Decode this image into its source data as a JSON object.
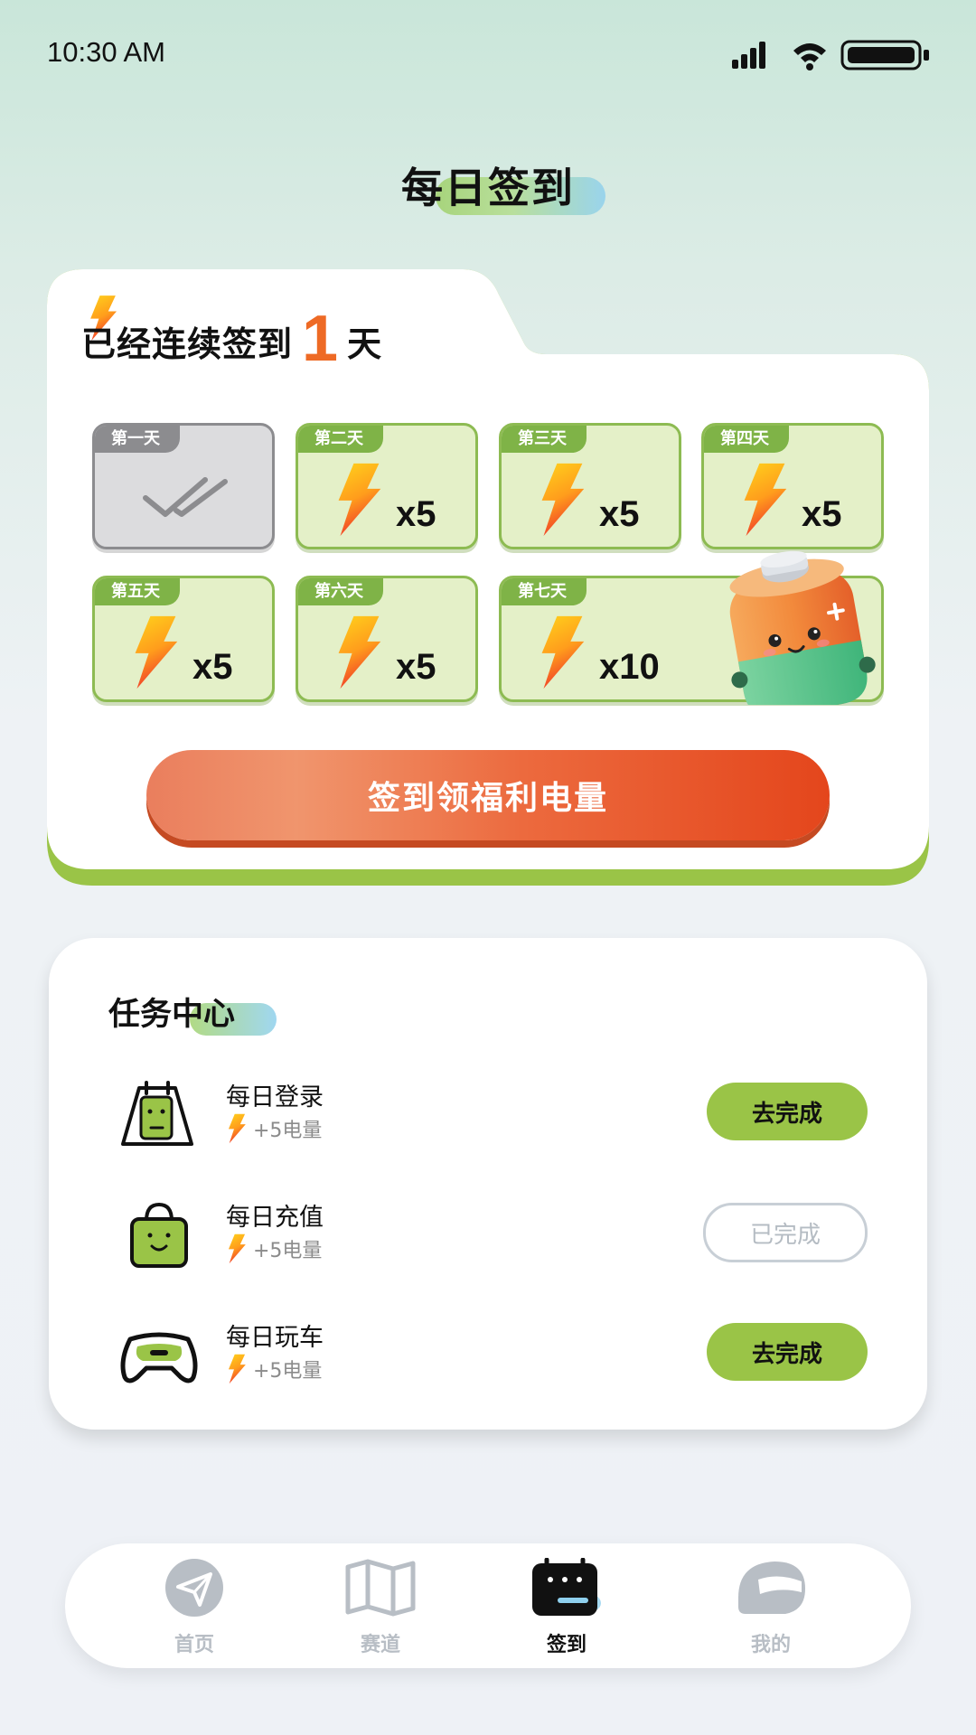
{
  "status_bar": {
    "time": "10:30 AM"
  },
  "page_title": "每日签到",
  "signin": {
    "streak_prefix": "已经连续签到",
    "streak_days": "1",
    "streak_suffix": "天",
    "days": [
      {
        "label": "第一天",
        "amount": "",
        "status": "done"
      },
      {
        "label": "第二天",
        "amount": "x5",
        "status": "pending"
      },
      {
        "label": "第三天",
        "amount": "x5",
        "status": "pending"
      },
      {
        "label": "第四天",
        "amount": "x5",
        "status": "pending"
      },
      {
        "label": "第五天",
        "amount": "x5",
        "status": "pending"
      },
      {
        "label": "第六天",
        "amount": "x5",
        "status": "pending"
      },
      {
        "label": "第七天",
        "amount": "x10",
        "status": "pending"
      }
    ],
    "button_label": "签到领福利电量"
  },
  "tasks": {
    "title": "任务中心",
    "items": [
      {
        "name": "每日登录",
        "reward": "+5电量",
        "button": "去完成",
        "state": "todo",
        "icon": "calendar-icon"
      },
      {
        "name": "每日充值",
        "reward": "+5电量",
        "button": "已完成",
        "state": "done",
        "icon": "shopping-bag-icon"
      },
      {
        "name": "每日玩车",
        "reward": "+5电量",
        "button": "去完成",
        "state": "todo",
        "icon": "gamepad-icon"
      }
    ]
  },
  "nav": {
    "items": [
      {
        "label": "首页",
        "icon": "paper-plane-icon",
        "active": false
      },
      {
        "label": "赛道",
        "icon": "map-icon",
        "active": false
      },
      {
        "label": "签到",
        "icon": "calendar-icon",
        "active": true
      },
      {
        "label": "我的",
        "icon": "helmet-icon",
        "active": false
      }
    ]
  },
  "colors": {
    "accent_green": "#9ac447",
    "accent_orange": "#ee6a25",
    "button_red": "#e4461c"
  }
}
